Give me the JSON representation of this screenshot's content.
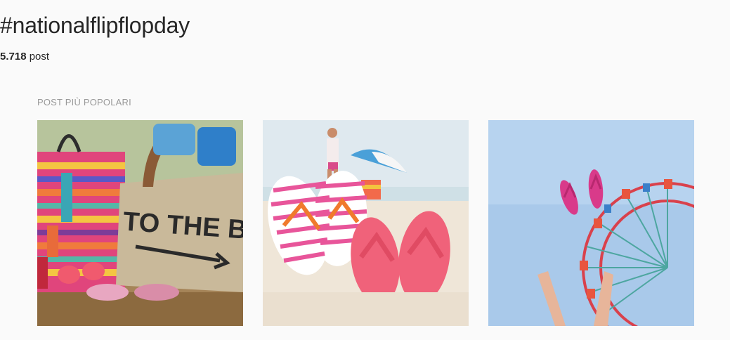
{
  "header": {
    "hashtag": "#nationalflipflopday",
    "post_count": "5.718",
    "post_unit": "post"
  },
  "section": {
    "label": "POST PIÙ POPOLARI"
  },
  "posts": [
    {
      "name": "post-beach-bags",
      "bag_text": "TO THE BEACH",
      "colors": {
        "bag": "#c9b99a",
        "pink": "#e85a8c",
        "teal": "#3aa6b5"
      }
    },
    {
      "name": "post-flipflops-sand",
      "colors": {
        "sand": "#efe6d8",
        "sky": "#dfe9ef",
        "pink": "#f0627a",
        "stripe": "#e8559a"
      }
    },
    {
      "name": "post-ferris-wheel",
      "colors": {
        "sky": "#a9c9ea",
        "wheel": "#d9414c",
        "spokes": "#4da6a0",
        "pink": "#d93a8a"
      }
    }
  ]
}
